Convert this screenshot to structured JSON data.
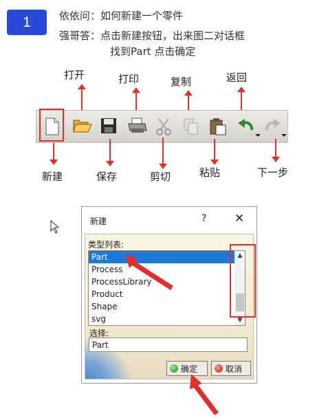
{
  "step": {
    "number": "1"
  },
  "qa": {
    "question": "依依问：如何新建一个零件",
    "answer_line1": "强哥答：点击新建按钮，出来图二对话框",
    "answer_line2": "找到Part  点击确定"
  },
  "toolbar": {
    "labels": {
      "open": "打开",
      "print": "打印",
      "copy": "复制",
      "back": "返回",
      "new": "新建",
      "save": "保存",
      "cut": "剪切",
      "paste": "粘贴",
      "next": "下一步"
    },
    "icons": [
      "new-icon",
      "open-icon",
      "save-icon",
      "print-icon",
      "cut-icon",
      "copy-icon",
      "paste-icon",
      "undo-icon",
      "redo-icon"
    ]
  },
  "dialog": {
    "title": "新建",
    "help": "?",
    "close": "✕",
    "type_list_label": "类型列表:",
    "types": [
      "Part",
      "Process",
      "ProcessLibrary",
      "Product",
      "Shape",
      "svg"
    ],
    "selected_index": 0,
    "choose_label": "选择:",
    "choose_value": "Part",
    "ok_label": "确定",
    "cancel_label": "取消"
  },
  "colors": {
    "badge": "#2b49d8",
    "highlight": "#e0302e",
    "selection": "#1e78d7"
  }
}
